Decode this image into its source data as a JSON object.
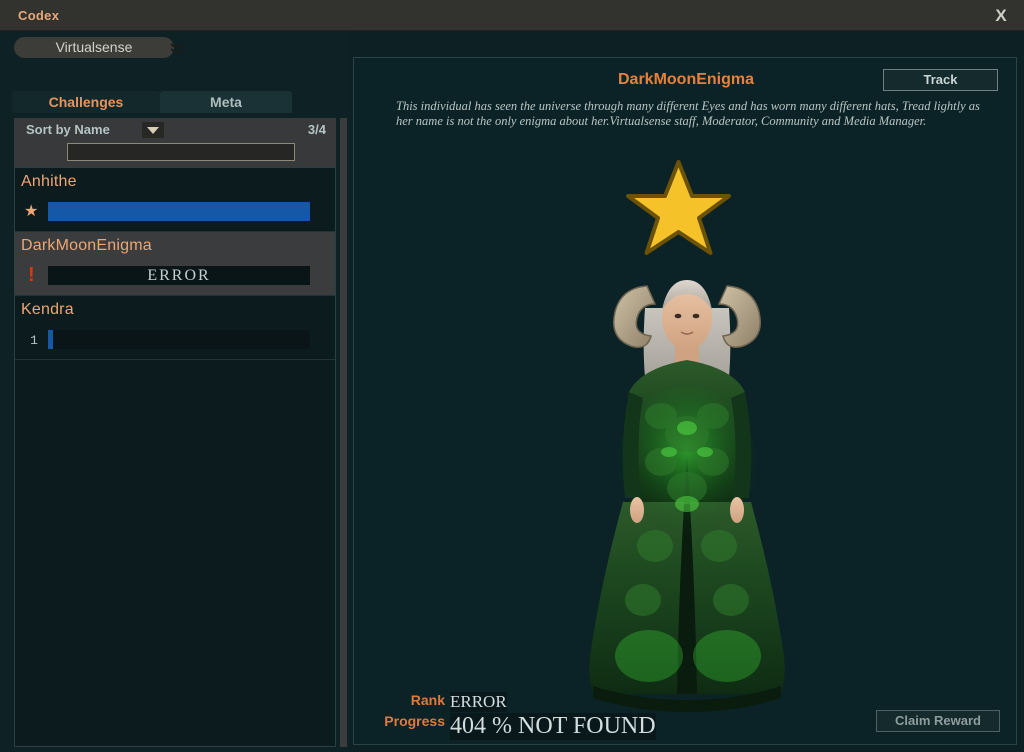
{
  "window": {
    "title": "Codex",
    "close_label": "X"
  },
  "sidebar": {
    "realm_selector": {
      "value": "Virtualsense",
      "icon": "double-chevron-down-icon"
    },
    "tabs": [
      {
        "label": "Challenges",
        "active": true
      },
      {
        "label": "Meta",
        "active": false
      }
    ],
    "toolbar": {
      "sort_label": "Sort by Name",
      "sort_icon": "caret-down-icon",
      "progress_count": "3/4",
      "search_value": "",
      "search_placeholder": ""
    },
    "entries": [
      {
        "name": "Anhithe",
        "rank_icon": "star-icon",
        "rank": "",
        "bar_text": "",
        "bar_percent": 100,
        "selected": false
      },
      {
        "name": "DarkMoonEnigma",
        "rank_icon": "warning-exclamation-icon",
        "rank": "",
        "bar_text": "ERROR",
        "bar_percent": 0,
        "selected": true
      },
      {
        "name": "Kendra",
        "rank_icon": "",
        "rank": "1",
        "bar_text": "",
        "bar_percent": 2,
        "selected": false
      }
    ]
  },
  "detail": {
    "title": "DarkMoonEnigma",
    "track_label": "Track",
    "description": "This individual has seen the universe through many different Eyes and has worn many different hats, Tread lightly as her name is not the only enigma about her.Virtualsense staff, Moderator, Community and Media Manager.",
    "badge_icon": "gold-star-badge-icon",
    "portrait_alt": "character-portrait",
    "stats": [
      {
        "label": "Rank",
        "value": "ERROR"
      },
      {
        "label": "Progress",
        "value": "404 % NOT FOUND"
      }
    ],
    "claim_label": "Claim Reward"
  },
  "colors": {
    "accent_orange": "#e9803a",
    "name_orange": "#eda674",
    "progress_blue": "#1558a8",
    "error_red": "#d23a12",
    "star_gold": "#f6c22a",
    "panel_bg": "#0b2326",
    "titlebar_bg": "#32322f"
  }
}
